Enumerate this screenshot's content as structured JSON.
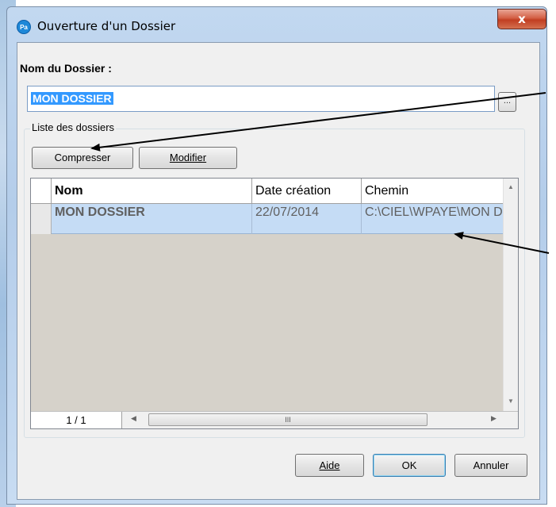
{
  "window": {
    "title": "Ouverture d'un Dossier",
    "app_icon_text": "Pa",
    "close_glyph": "x"
  },
  "form": {
    "folder_name_label": "Nom du Dossier :",
    "folder_name_value": "MON DOSSIER",
    "browse_label": "..."
  },
  "list_group": {
    "label": "Liste des dossiers",
    "compress_button": "Compresser",
    "modify_button": "Modifier"
  },
  "table": {
    "columns": [
      "Nom",
      "Date création",
      "Chemin"
    ],
    "rows": [
      {
        "nom": "MON DOSSIER",
        "date": "22/07/2014",
        "chemin": "C:\\CIEL\\WPAYE\\MON DOSSIER"
      }
    ],
    "page_indicator": "1 / 1",
    "scroll_grip": "III"
  },
  "footer": {
    "help_button": "Aide",
    "ok_button": "OK",
    "cancel_button": "Annuler"
  },
  "icons": {
    "app": "pa-app-icon",
    "close": "close-icon",
    "scroll_up": "scroll-up-arrow-icon",
    "scroll_down": "scroll-down-arrow-icon",
    "scroll_left": "scroll-left-arrow-icon",
    "scroll_right": "scroll-right-arrow-icon"
  },
  "colors": {
    "selection": "#3399ff",
    "selected_row": "#c5dcf5",
    "grid_empty": "#d6d2ca",
    "close_button": "#c13e22"
  }
}
